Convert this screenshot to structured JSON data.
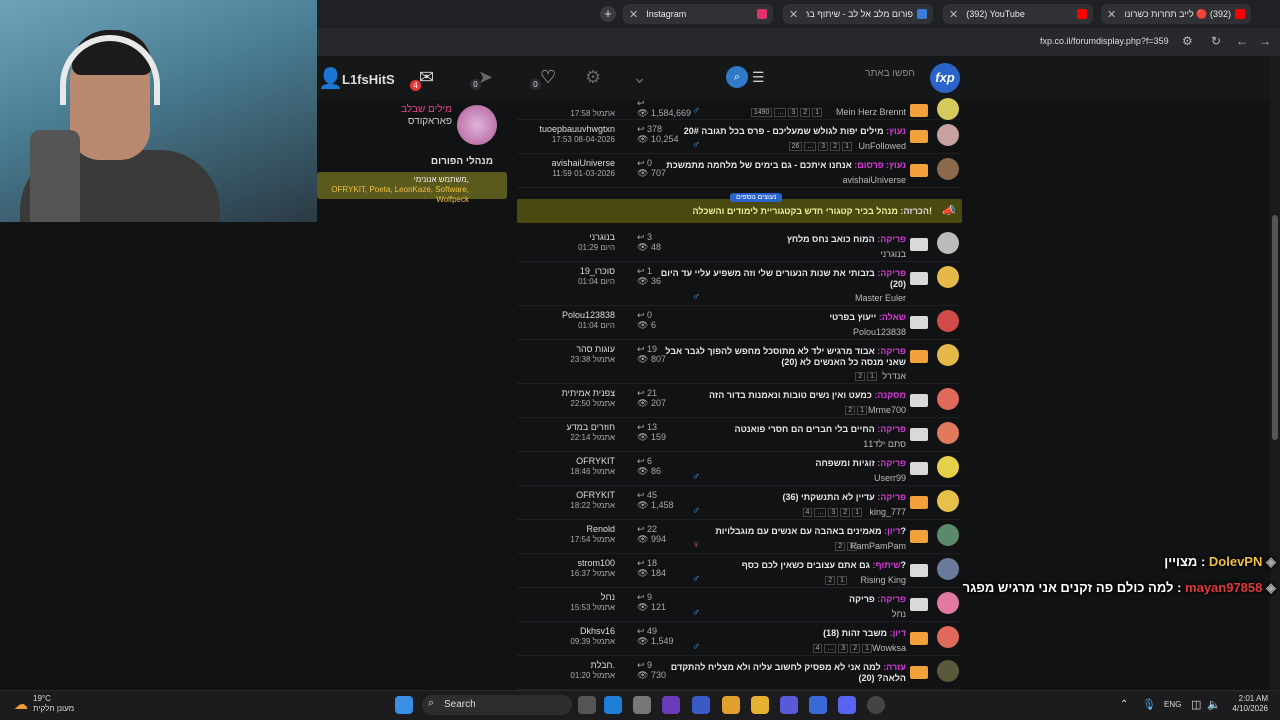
{
  "browser": {
    "tabs": [
      {
        "label": "Instagram",
        "favicon_color": "#e1306c"
      },
      {
        "label": "פורום מלב אל לב - שיתוף ברגש...",
        "favicon_color": "#3a7bd5"
      },
      {
        "label": "(392) YouTube",
        "favicon_color": "#ff0000"
      },
      {
        "label": "(392) 🔴 לייב תחרות כשרונות",
        "favicon_color": "#ff0000"
      }
    ],
    "new_tab": "+",
    "url": "fxp.co.il/forumdisplay.php?f=359"
  },
  "site": {
    "logo": "fxp",
    "search_placeholder": "חפשו באתר",
    "username": "L1fsHitS",
    "mail_count": "4",
    "notif_count": "0",
    "likes_count": "0"
  },
  "sidebar": {
    "title": "מילים שבלב",
    "subtitle": "פאראקודס",
    "managers": "מנהלי הפורום",
    "online_label": "משתמש אנונימי,",
    "online_users": "OFRYKIT, Poeta, LeonKaze, Software, Wolfpeck"
  },
  "announcement": {
    "badge": "נעוצים נוספים",
    "label": "הכרזה:",
    "text": "מנהל בכיר קטגורי חדש בקטגוריית לימודים והשכלה!"
  },
  "threads": [
    {
      "prefix": "",
      "title": "",
      "author": "Mein Herz Brennt",
      "pages": [
        "1490",
        "...",
        "3",
        "2",
        "1"
      ],
      "replies": "",
      "views": "1,584,669",
      "last_user": "",
      "last_time": "17:58 אתמול",
      "hot": true,
      "gender": "m",
      "avatar": "#d4c95a"
    },
    {
      "prefix": "נעוץ:",
      "title": "מילים יפות לגולש שמעליכם - פרס בכל תגובה 20#",
      "author": "UnFollowed",
      "pages": [
        "26",
        "...",
        "3",
        "2",
        "1"
      ],
      "replies": "378",
      "views": "10,254",
      "last_user": "tuoepbauuvhwgtxn",
      "last_time": "17:53 08-04-2026",
      "hot": true,
      "gender": "m",
      "avatar": "#c7a0a0"
    },
    {
      "prefix": "נעוץ: פרסום:",
      "title": "אנחנו איתכם - גם בימים של מלחמה מתמשכת",
      "author": "avishaiUniverse",
      "pages": [],
      "replies": "0",
      "views": "707",
      "last_user": "avishaiUniverse",
      "last_time": "11:59 01-03-2026",
      "hot": true,
      "gender": "",
      "avatar": "#8a6a4a"
    },
    {
      "prefix": "פריקה:",
      "title": "המוח כואב נחס מלחץ",
      "author": "בנוגרני",
      "pages": [],
      "replies": "3",
      "views": "48",
      "last_user": "בנוגרני",
      "last_time": "היום 01:29",
      "hot": false,
      "gender": "",
      "avatar": "#bbbbbb"
    },
    {
      "prefix": "פריקה:",
      "title": "בזבותי את שנות הנעורים שלי וזה משפיע עליי עד היום (20)",
      "author": "Master Euler",
      "pages": [],
      "replies": "1",
      "views": "36",
      "last_user": "סוכרו_19",
      "last_time": "היום 01:04",
      "hot": false,
      "gender": "m",
      "avatar": "#e6b84a"
    },
    {
      "prefix": "שאלה:",
      "title": "ייעוץ בפרטי",
      "author": "Polou123838",
      "pages": [],
      "replies": "0",
      "views": "6",
      "last_user": "Polou123838",
      "last_time": "היום 01:04",
      "hot": false,
      "gender": "",
      "avatar": "#d04a4a"
    },
    {
      "prefix": "פריקה:",
      "title": "אבוד מרגיש ילד לא מתוסכל מחפש להפוך לגבר אבל שאני מנסה כל האנשים לא (20)",
      "author": "אנדרל",
      "pages": [
        "2",
        "1"
      ],
      "replies": "19",
      "views": "807",
      "last_user": "עוגות סהר",
      "last_time": "אתמול 23:38",
      "hot": true,
      "gender": "",
      "avatar": "#e6b84a"
    },
    {
      "prefix": "מסקנה:",
      "title": "כמעט ואין נשים טובות ונאמנות בדור הזה",
      "author": "Mrme700",
      "pages": [
        "2",
        "1"
      ],
      "replies": "21",
      "views": "207",
      "last_user": "צפנית אמיתית",
      "last_time": "אתמול 22:50",
      "hot": false,
      "gender": "",
      "avatar": "#e06a5a"
    },
    {
      "prefix": "פריקה:",
      "title": "החיים בלי חברים הם חסרי פואנטה",
      "author": "סתם ילד11",
      "pages": [],
      "replies": "13",
      "views": "159",
      "last_user": "חוזרים במדע",
      "last_time": "אתמול 22:14",
      "hot": false,
      "gender": "",
      "avatar": "#e07a5a"
    },
    {
      "prefix": "פריקה:",
      "title": "זוגיות ומשפחה",
      "author": "Userr99",
      "pages": [],
      "replies": "6",
      "views": "86",
      "last_user": "OFRYKIT",
      "last_time": "אתמול 18:46",
      "hot": false,
      "gender": "m",
      "avatar": "#e6d04a"
    },
    {
      "prefix": "פריקה:",
      "title": "עדיין לא התנשקתי (36)",
      "author": "king_777",
      "pages": [
        "4",
        "...",
        "3",
        "2",
        "1"
      ],
      "replies": "45",
      "views": "1,458",
      "last_user": "OFRYKIT",
      "last_time": "אתמול 18:22",
      "hot": true,
      "gender": "m",
      "avatar": "#e6c04a"
    },
    {
      "prefix": "דיון:",
      "title": "מאמינים באהבה עם אנשים עם מוגבלויות?",
      "author": "RamPamPam",
      "pages": [
        "2",
        "1"
      ],
      "replies": "22",
      "views": "994",
      "last_user": "Renold",
      "last_time": "אתמול 17:54",
      "hot": true,
      "gender": "f",
      "avatar": "#5a8a6a"
    },
    {
      "prefix": "שיתוף:",
      "title": "גם אתם עצובים כשאין לכם כסף?",
      "author": "Rising King",
      "pages": [
        "2",
        "1"
      ],
      "replies": "18",
      "views": "184",
      "last_user": "strom100",
      "last_time": "אתמול 16:37",
      "hot": false,
      "gender": "m",
      "avatar": "#6a7a9a"
    },
    {
      "prefix": "פריקה:",
      "title": "פריקה",
      "author": "נחל",
      "pages": [],
      "replies": "9",
      "views": "121",
      "last_user": "נחל",
      "last_time": "אתמול 15:53",
      "hot": false,
      "gender": "m",
      "avatar": "#e07aa0"
    },
    {
      "prefix": "דיון:",
      "title": "משבר זהות (18)",
      "author": "Wowksa",
      "pages": [
        "4",
        "...",
        "3",
        "2",
        "1"
      ],
      "replies": "49",
      "views": "1,549",
      "last_user": "Dkhsv16",
      "last_time": "אתמול 09:39",
      "hot": true,
      "gender": "m",
      "avatar": "#e06a5a"
    },
    {
      "prefix": "עזרה:",
      "title": "למה אני לא מפסיק לחשוב עליה ולא מצליח להתקדם הלאה? (20)",
      "author": "",
      "pages": [],
      "replies": "9",
      "views": "730",
      "last_user": "חבלת.",
      "last_time": "אתמול 01:20",
      "hot": true,
      "gender": "",
      "avatar": "#5a5a3a"
    }
  ],
  "chat": [
    {
      "user": "DolevPN",
      "prefix": "מצויין :",
      "user_color": "#f0c040",
      "text_color": "#ffffff"
    },
    {
      "user": "mayan97858",
      "prefix": "למה כולם פה זקנים אני מרגיש מפגר :",
      "user_color": "#e03a3a",
      "text_color": "#ffffff"
    }
  ],
  "taskbar": {
    "temp": "19°C",
    "weather": "מעונן חלקית",
    "search": "Search",
    "lang": "ENG",
    "time": "2:01 AM",
    "date": "4/10/2026"
  }
}
